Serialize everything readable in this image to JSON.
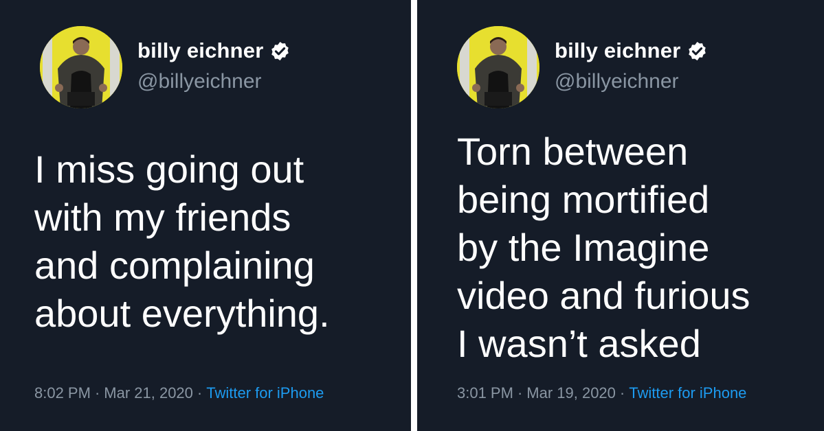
{
  "tweets": [
    {
      "name": "billy eichner",
      "handle": "@billyeichner",
      "text": "I miss going out\nwith my friends\nand complaining\nabout everything.",
      "time": "8:02 PM",
      "date": "Mar 21, 2020",
      "source": "Twitter for iPhone",
      "separator": "·",
      "icons": [
        "avatar",
        "verified-badge-icon"
      ]
    },
    {
      "name": "billy eichner",
      "handle": "@billyeichner",
      "text": "Torn between\nbeing mortified\nby the Imagine\nvideo and furious\nI wasn’t asked",
      "time": "3:01 PM",
      "date": "Mar 19, 2020",
      "source": "Twitter for iPhone",
      "separator": "·",
      "icons": [
        "avatar",
        "verified-badge-icon"
      ]
    }
  ],
  "colors": {
    "background": "#151c28",
    "text": "#ffffff",
    "secondary": "#8a96a3",
    "link": "#1d9bf0",
    "avatar_bg": "#e7df2f"
  }
}
